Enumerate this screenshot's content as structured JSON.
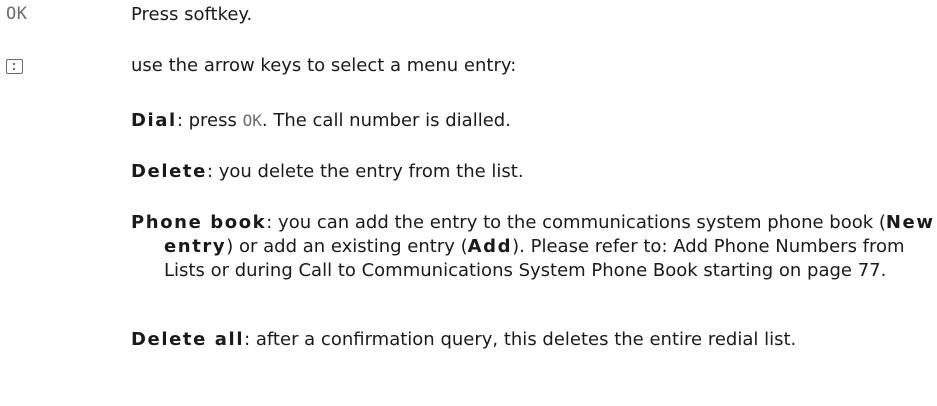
{
  "steps": [
    {
      "key": "OK",
      "text": "Press softkey."
    },
    {
      "key_icon": "arrow-keys-icon",
      "text": "use the arrow keys to select a menu entry:"
    }
  ],
  "entries": {
    "dial": {
      "term": "Dial",
      "before": ": press ",
      "softkey": "OK",
      "after": ". The call number is dialled."
    },
    "delete": {
      "term": "Delete",
      "rest": ": you delete the entry from the list."
    },
    "phone_book": {
      "term": "Phone book",
      "rest1": ": you can add the entry to the communications system phone book (",
      "new_entry": "New entry",
      "rest2": ") or add an existing entry (",
      "add": "Add",
      "rest3": "). Please refer to: Add Phone Numbers from Lists or during Call to Communications System Phone Book starting on page 77."
    },
    "delete_all": {
      "term": "Delete all",
      "rest": ": after a confirmation query, this deletes the entire redial list."
    }
  }
}
